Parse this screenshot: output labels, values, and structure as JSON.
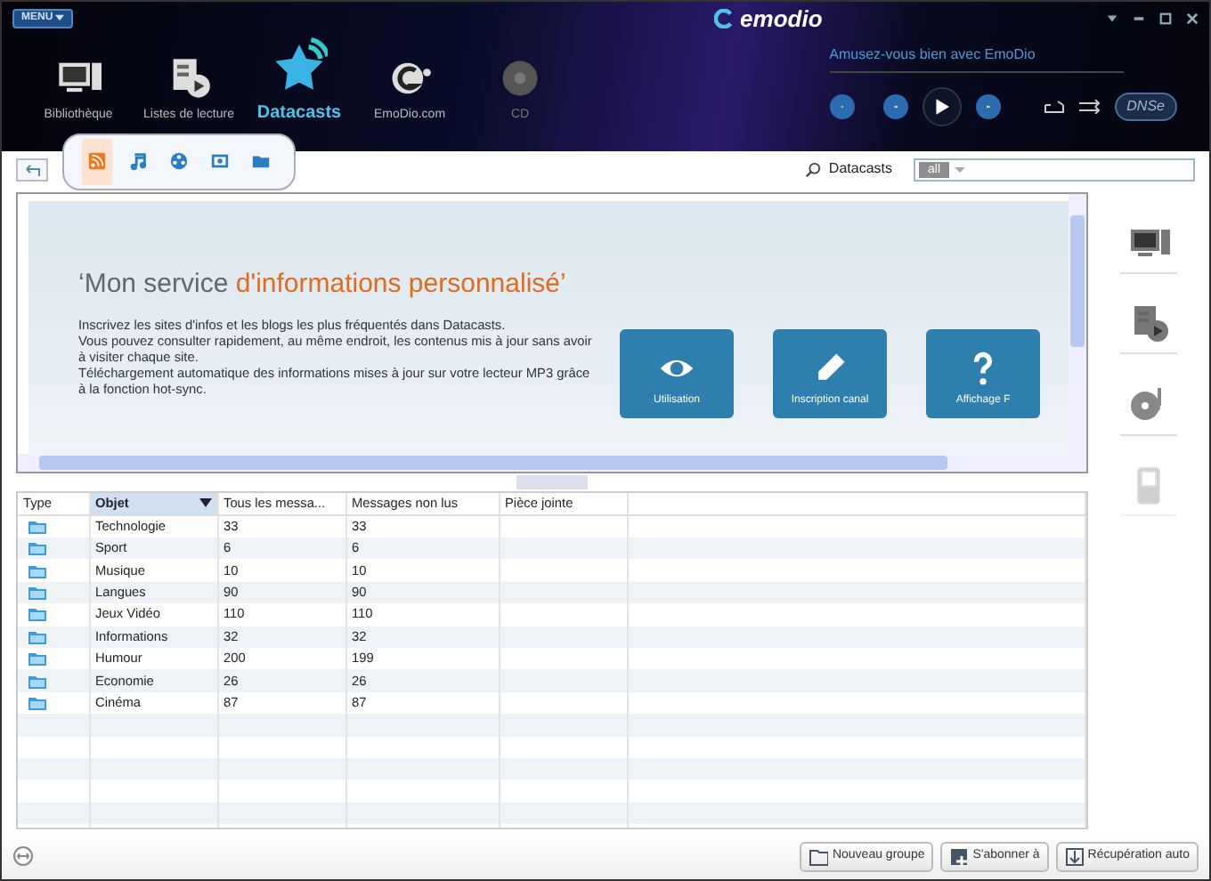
{
  "window": {
    "menu": "MENU",
    "logo": "emodio"
  },
  "nav": [
    {
      "label": "Bibliothèque",
      "kind": "computer",
      "selected": false,
      "disabled": false
    },
    {
      "label": "Listes de lecture",
      "kind": "playlist",
      "selected": false,
      "disabled": false
    },
    {
      "label": "Datacasts",
      "kind": "star",
      "selected": true,
      "disabled": false
    },
    {
      "label": "EmoDio.com",
      "kind": "globe",
      "selected": false,
      "disabled": false
    },
    {
      "label": "CD",
      "kind": "disc",
      "selected": false,
      "disabled": true
    }
  ],
  "player": {
    "tagline": "Amusez-vous bien avec EmoDio",
    "dnse": "DNSe"
  },
  "subtabs": [
    {
      "kind": "rss",
      "selected": true
    },
    {
      "kind": "music",
      "selected": false
    },
    {
      "kind": "video",
      "selected": false
    },
    {
      "kind": "photo",
      "selected": false
    },
    {
      "kind": "folder",
      "selected": false
    }
  ],
  "search": {
    "label": "Datacasts",
    "filter": "all"
  },
  "banner": {
    "title_lead": "‘Mon service ",
    "title_highlight": "d'informations personnalisé’",
    "paragraphs": [
      "Inscrivez les sites d'infos et les blogs les plus fréquentés dans Datacasts.",
      "Vous pouvez consulter rapidement, au même endroit, les contenus mis à jour sans avoir à visiter chaque site.",
      "Téléchargement automatique des informations mises à jour sur votre lecteur MP3 grâce à la fonction hot-sync."
    ],
    "tiles": [
      {
        "label": "Utilisation",
        "kind": "eye"
      },
      {
        "label": "Inscription canal",
        "kind": "pencil"
      },
      {
        "label": "Affichage F",
        "kind": "question"
      }
    ]
  },
  "table": {
    "columns": [
      {
        "label": "Type",
        "sorted": false
      },
      {
        "label": "Objet",
        "sorted": true
      },
      {
        "label": "Tous les messa...",
        "sorted": false
      },
      {
        "label": "Messages non lus",
        "sorted": false
      },
      {
        "label": "Pièce jointe",
        "sorted": false
      }
    ],
    "rows": [
      [
        "",
        "Technologie",
        "33",
        "33"
      ],
      [
        "",
        "Sport",
        "6",
        "6"
      ],
      [
        "",
        "Musique",
        "10",
        "10"
      ],
      [
        "",
        "Langues",
        "90",
        "90"
      ],
      [
        "",
        "Jeux Vidéo",
        "110",
        "110"
      ],
      [
        "",
        "Informations",
        "32",
        "32"
      ],
      [
        "",
        "Humour",
        "200",
        "199"
      ],
      [
        "",
        "Economie",
        "26",
        "26"
      ],
      [
        "",
        "Cinéma",
        "87",
        "87"
      ]
    ]
  },
  "sidebar": [
    {
      "kind": "computer",
      "disabled": false
    },
    {
      "kind": "playlist",
      "disabled": false
    },
    {
      "kind": "disc-music",
      "disabled": false
    },
    {
      "kind": "player",
      "disabled": true
    }
  ],
  "buttons": [
    {
      "label": "Nouveau groupe",
      "kind": "folder"
    },
    {
      "label": "S'abonner à",
      "kind": "subscribe"
    },
    {
      "label": "Récupération auto",
      "kind": "download"
    }
  ]
}
